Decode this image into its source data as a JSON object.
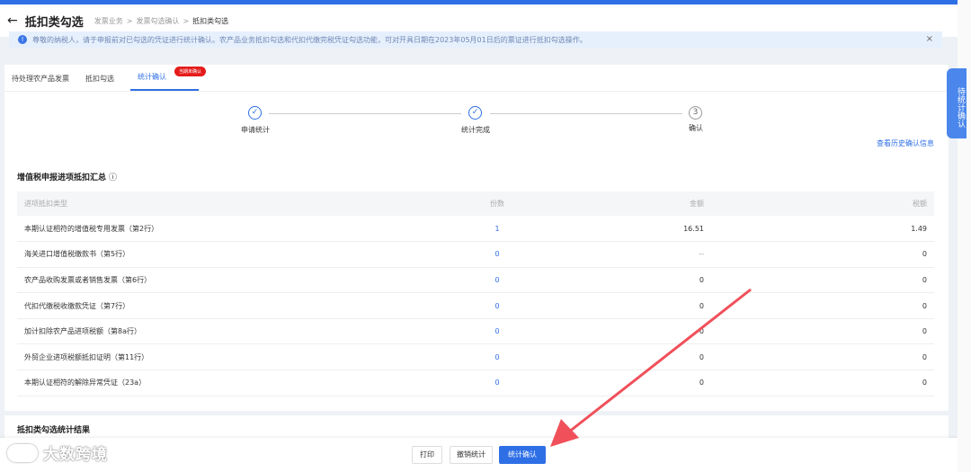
{
  "header": {
    "title": "抵扣类勾选",
    "breadcrumb": [
      "发票业务",
      "发票勾选确认",
      "抵扣类勾选"
    ]
  },
  "notice": {
    "text": "尊敬的纳税人，请于申报前对已勾选的凭证进行统计确认。农产品业务抵扣勾选和代扣代缴完税凭证勾选功能，可对开具日期在2023年05月01日后的票证进行抵扣勾选操作。",
    "close": "×"
  },
  "tabs": [
    {
      "label": "待处理农产品发票"
    },
    {
      "label": "抵扣勾选"
    },
    {
      "label": "统计确认",
      "badge": "当期未确认"
    }
  ],
  "steps": [
    {
      "label": "申请统计",
      "status": "done"
    },
    {
      "label": "统计完成",
      "status": "done"
    },
    {
      "label": "确认",
      "status": "pending",
      "number": "3"
    }
  ],
  "history_link": "查看历史确认信息",
  "summary": {
    "title": "增值税申报进项抵扣汇总",
    "columns": [
      "进项抵扣类型",
      "份数",
      "金额",
      "税额"
    ],
    "rows": [
      {
        "type": "本期认证相符的增值税专用发票（第2行）",
        "count": "1",
        "amount": "16.51",
        "tax": "1.49"
      },
      {
        "type": "海关进口增值税缴款书（第5行）",
        "count": "0",
        "amount": "--",
        "tax": "0"
      },
      {
        "type": "农产品收购发票或者销售发票（第6行）",
        "count": "0",
        "amount": "0",
        "tax": "0"
      },
      {
        "type": "代扣代缴税收缴款凭证（第7行）",
        "count": "0",
        "amount": "0",
        "tax": "0"
      },
      {
        "type": "加计扣除农产品进项税额（第8a行）",
        "count": "0",
        "amount": "0",
        "tax": "0"
      },
      {
        "type": "外贸企业进项税额抵扣证明（第11行）",
        "count": "0",
        "amount": "0",
        "tax": "0"
      },
      {
        "type": "本期认证相符的解除异常凭证（23a）",
        "count": "0",
        "amount": "0",
        "tax": "0"
      }
    ]
  },
  "results_title": "抵扣类勾选统计结果",
  "buttons": {
    "print": "打印",
    "cancel": "撤销统计",
    "confirm": "统计确认"
  },
  "side_tab": "待统计确认",
  "watermark": "大数跨境",
  "colors": {
    "primary": "#2e6fe6",
    "badge": "#e41b1b",
    "arrow": "#f0505a"
  }
}
